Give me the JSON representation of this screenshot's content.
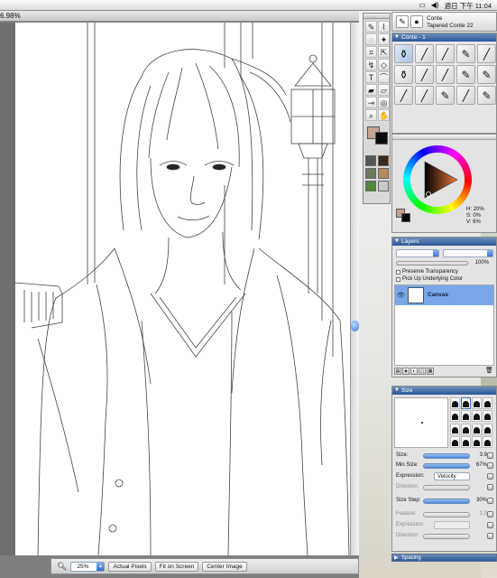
{
  "menubar": {
    "clock": "週日 下午 11:04"
  },
  "document": {
    "zoom_readout": "6.98%"
  },
  "statusbar": {
    "zoom_value": "25%",
    "actual_pixels": "Actual Pixels",
    "fit_on_screen": "Fit on Screen",
    "center_image": "Center Image"
  },
  "brush_selector": {
    "category": "Conte",
    "variant": "Tapered Conte 22"
  },
  "brush_panel": {
    "title": "Conte - 1",
    "variant_count": 15
  },
  "color_panel": {
    "h": "H: 20%",
    "s": "S: 0%",
    "v": "V: 6%"
  },
  "layers_panel": {
    "title": "Layers",
    "opacity": "100%",
    "preserve_transparency": "Preserve Transparency",
    "pick_up_underlying": "Pick Up Underlying Color",
    "layer_name": "Canvas"
  },
  "size_panel": {
    "title": "Size",
    "size_label": "Size:",
    "size_value": "3.9",
    "min_size_label": "Min Size:",
    "min_size_value": "67%",
    "expression_label": "Expression:",
    "expression_value": "Velocity",
    "direction_label": "Direction:",
    "size_step_label": "Size Step:",
    "size_step_value": "30%",
    "feature_label": "Feature:",
    "feature_value": "1.0",
    "expression2_label": "Expression:",
    "direction2_label": "Direction:"
  },
  "spacing_panel": {
    "title": "Spacing"
  },
  "colors": {
    "selection_blue": "#79a7e8",
    "palette_title": "#2a579a",
    "main_color": "#c9a48e",
    "secondary_color": "#0c0c0c"
  }
}
